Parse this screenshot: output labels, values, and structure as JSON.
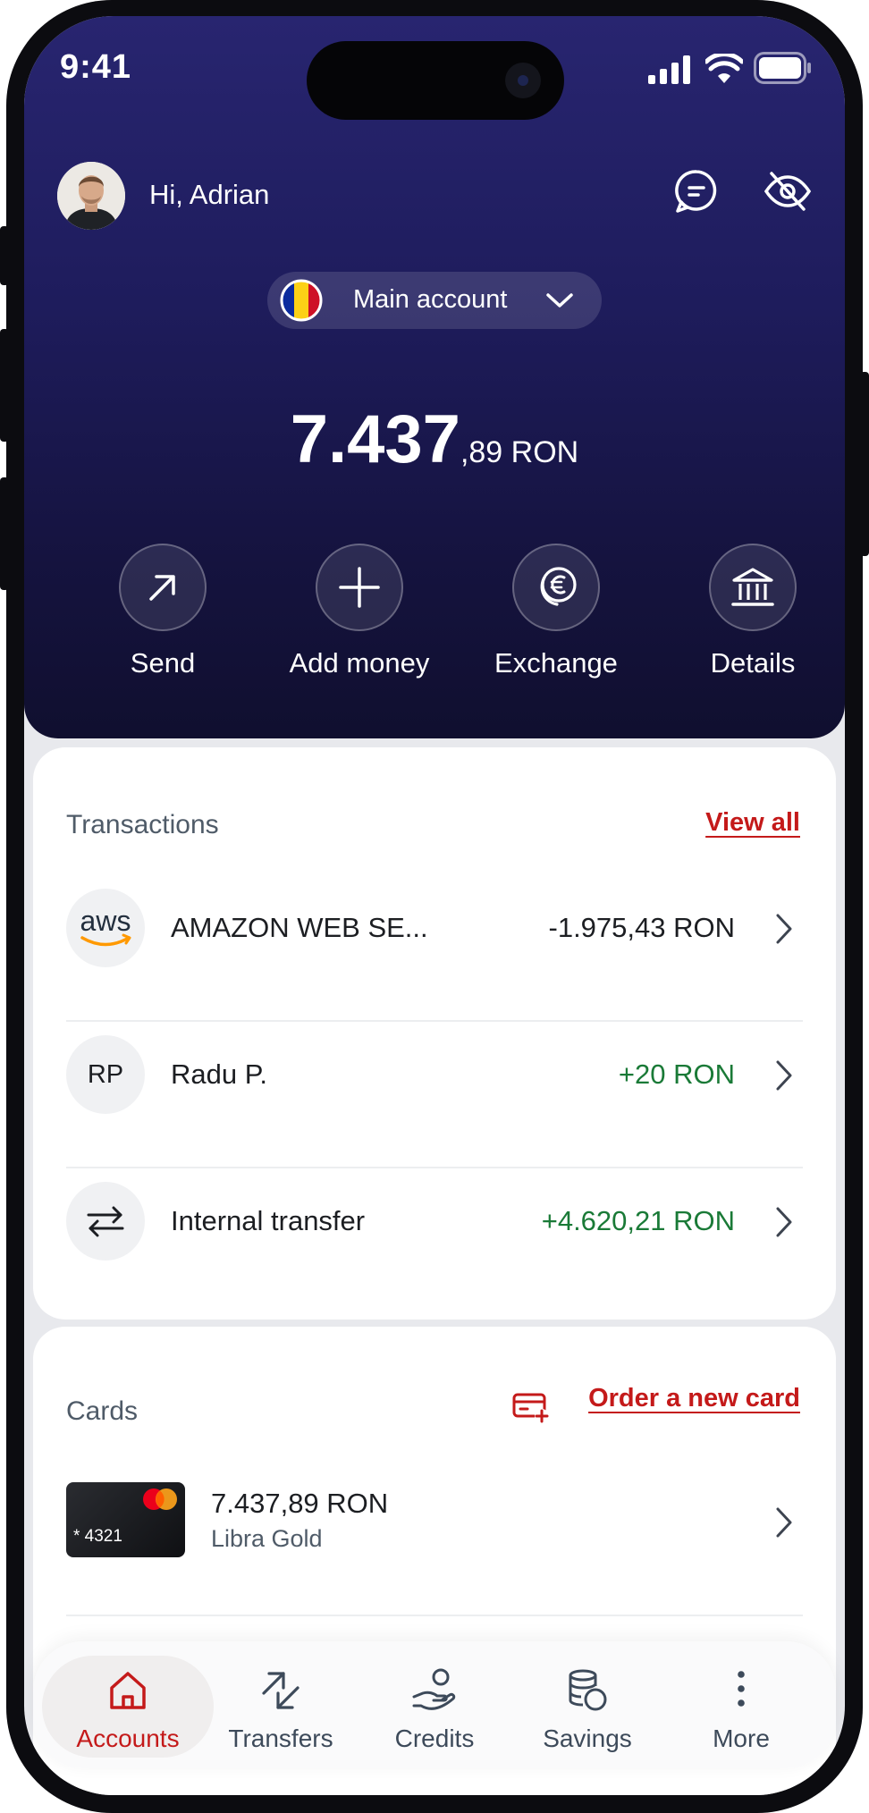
{
  "status_bar": {
    "time": "9:41"
  },
  "header": {
    "greeting": "Hi, Adrian",
    "account_selector": {
      "label": "Main account"
    },
    "balance": {
      "integer": "7.437",
      "decimals": ",89 RON"
    },
    "actions": [
      {
        "label": "Send",
        "icon": "arrow-up-right-icon"
      },
      {
        "label": "Add money",
        "icon": "plus-icon"
      },
      {
        "label": "Exchange",
        "icon": "euro-exchange-icon"
      },
      {
        "label": "Details",
        "icon": "bank-icon"
      }
    ]
  },
  "transactions": {
    "title": "Transactions",
    "view_all": "View all",
    "items": [
      {
        "logo_text": "aws",
        "name": "AMAZON WEB SE...",
        "amount": "-1.975,43 RON",
        "type": "debit"
      },
      {
        "initials": "RP",
        "name": "Radu P.",
        "amount": "+20 RON",
        "type": "credit"
      },
      {
        "icon": "swap-arrows-icon",
        "name": "Internal transfer",
        "amount": "+4.620,21 RON",
        "type": "credit"
      }
    ]
  },
  "cards": {
    "title": "Cards",
    "order_link": "Order a new card",
    "items": [
      {
        "masked_number": "* 4321",
        "balance": "7.437,89 RON",
        "name": "Libra Gold"
      }
    ]
  },
  "bottom_nav": {
    "items": [
      {
        "label": "Accounts",
        "icon": "home-icon",
        "active": true
      },
      {
        "label": "Transfers",
        "icon": "transfer-arrows-icon",
        "active": false
      },
      {
        "label": "Credits",
        "icon": "hand-coin-icon",
        "active": false
      },
      {
        "label": "Savings",
        "icon": "coins-stack-icon",
        "active": false
      },
      {
        "label": "More",
        "icon": "more-dots-icon",
        "active": false
      }
    ]
  },
  "colors": {
    "header_top": "#282570",
    "header_bottom": "#100f2f",
    "accent_red": "#c41a1a",
    "credit_green": "#1a7a37",
    "debit_text": "#1c1e22"
  }
}
